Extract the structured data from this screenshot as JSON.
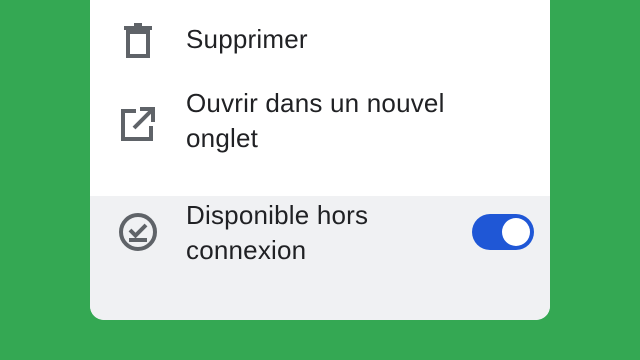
{
  "menu": {
    "items": [
      {
        "label": "Supprimer",
        "icon": "trash-icon"
      },
      {
        "label": "Ouvrir dans un nouvel onglet",
        "icon": "open-in-new-icon"
      },
      {
        "label": "Disponible hors connexion",
        "icon": "offline-check-icon",
        "toggle_on": true
      }
    ]
  },
  "colors": {
    "background": "#34a853",
    "toggle_accent": "#1f57d6",
    "highlight_row": "#f0f1f3",
    "icon": "#5f6368"
  }
}
